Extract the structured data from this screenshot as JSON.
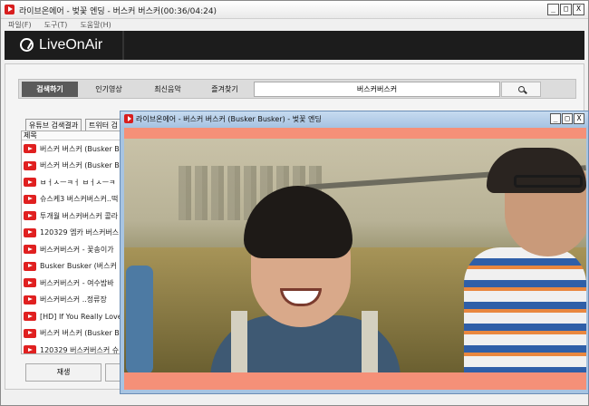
{
  "window": {
    "title": "라이브온에어 - 벚꽃 엔딩 - 버스커 버스커(00:36/04:24)",
    "controls": [
      "_",
      "□",
      "X"
    ]
  },
  "menu": [
    "파일(F)",
    "도구(T)",
    "도움말(H)"
  ],
  "brand": {
    "name": "LiveOnAir"
  },
  "tabs": [
    {
      "label": "검색하기",
      "active": true
    },
    {
      "label": "인기영상",
      "active": false
    },
    {
      "label": "최신음악",
      "active": false
    },
    {
      "label": "즐겨찾기",
      "active": false
    }
  ],
  "search": {
    "value": "버스커버스커"
  },
  "subtabs": [
    "유튜브 검색결과",
    "트위터 검"
  ],
  "list": {
    "header": "제목",
    "items": [
      "버스커 버스커 (Busker B",
      "버스커 버스커 (Busker B",
      "ㅂㅓㅅㅡㅋㅓ ㅂㅓㅅㅡㅋ",
      "슈스케3 버스커버스커..떡",
      "투개월 버스커버스커 콜라",
      "120329 엠카 버스커버스",
      "버스커버스커 - 꽃송이가",
      "Busker Busker (버스커 버",
      "버스커버스커 - 여수밤바",
      "버스커버스커 ..정류장",
      "[HD] If You Really Love",
      "버스커 버스커 (Busker B",
      "120329 버스커버스커 슈"
    ]
  },
  "buttons": {
    "play": "재생"
  },
  "player": {
    "title": "라이브온에어 - 버스커 버스커 (Busker Busker) - 벚꽃 엔딩",
    "controls": [
      "_",
      "□",
      "X"
    ]
  },
  "colors": {
    "video_letterbox": "#f59078",
    "player_titlebar": "#a9c5e3",
    "active_tab": "#5a5a5a",
    "banner": "#1c1c1c"
  }
}
